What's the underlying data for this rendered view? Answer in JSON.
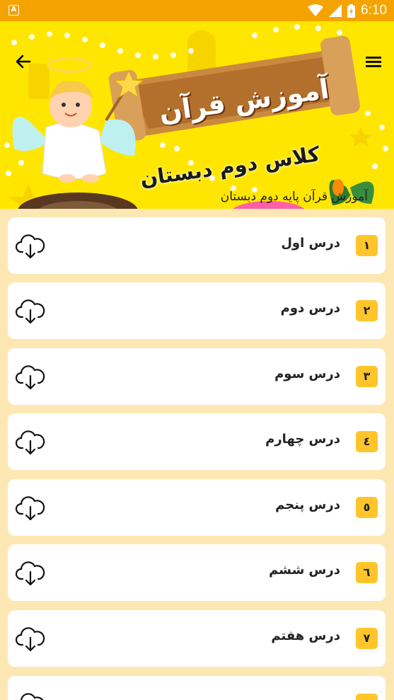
{
  "status_bar": {
    "notification_badge": "A",
    "time": "6:10",
    "icons": [
      "wifi-icon",
      "signal-icon",
      "battery-icon"
    ]
  },
  "header": {
    "back_icon": "arrow-left-icon",
    "menu_icon": "hamburger-menu-icon",
    "banner": {
      "title": "آموزش قرآن",
      "subtitle": "کلاس دوم دبستان",
      "caption": "آموزش قرآن پایه دوم دبستان"
    }
  },
  "lessons": [
    {
      "number": "١",
      "label": "درس اول"
    },
    {
      "number": "٢",
      "label": "درس دوم"
    },
    {
      "number": "٣",
      "label": "درس سوم"
    },
    {
      "number": "٤",
      "label": "درس چهارم"
    },
    {
      "number": "٥",
      "label": "درس پنجم"
    },
    {
      "number": "٦",
      "label": "درس ششم"
    },
    {
      "number": "٧",
      "label": "درس هفتم"
    },
    {
      "number": "",
      "label": ""
    }
  ],
  "colors": {
    "status_bar": "#f5a300",
    "banner_background": "#ffe600",
    "page_background": "#fde8b4",
    "number_badge": "#ffc52b",
    "card": "#ffffff"
  },
  "download_icon": "cloud-download-icon"
}
